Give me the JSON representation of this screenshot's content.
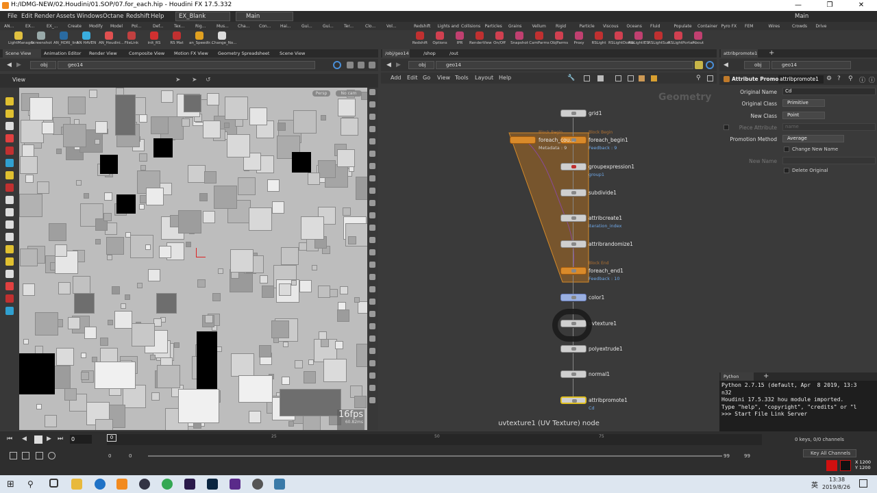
{
  "window": {
    "title": "H:/IDMG-NEW/02.Houdini/01.SOP/07.for_each.hip - Houdini FX 17.5.332"
  },
  "menu": [
    "File",
    "Edit",
    "Render",
    "Assets",
    "Windows",
    "Octane",
    "Redshift",
    "Help"
  ],
  "desktop": "EX_Blank",
  "main_label": "Main",
  "main_label_right": "Main",
  "shelf_tabs_left": [
    "AN...",
    "EX...",
    "EX_...",
    "Create",
    "Modify",
    "Model",
    "Pol...",
    "Def...",
    "Tex...",
    "Rig...",
    "Mus...",
    "Cha...",
    "Con...",
    "Hai...",
    "Gui...",
    "Gui...",
    "Ter...",
    "Clo...",
    "Vol..."
  ],
  "shelf_tabs_right": [
    "Redshift",
    "Lights and ...",
    "Collisions",
    "Particles",
    "Grains",
    "Vellum",
    "Rigid Bodies",
    "Particle Fl...",
    "Viscous Fl...",
    "Oceans",
    "Fluid Cont...",
    "Populate C...",
    "Container ...",
    "Pyro FX",
    "FEM",
    "Wires",
    "Crowds",
    "Drive Sim..."
  ],
  "tools_left": [
    "LightManager",
    "Screenshot",
    "AN_HDRI_link",
    "AN HAVEN",
    "AN_Houdini...",
    "FileLink",
    "init_RS",
    "RS Mat",
    "an_Speedtr...",
    "Change_No..."
  ],
  "tools_right": [
    "Redshift",
    "Options",
    "IPR",
    "RenderView",
    "On/Off",
    "Snapshot",
    "CamParms",
    "ObjParms",
    "Proxy",
    "RSLight",
    "RSLightDome",
    "RSLightIES",
    "RSLightSun",
    "RSLightPortal",
    "About"
  ],
  "left_tabs": [
    "Scene View",
    "Animation Editor",
    "Render View",
    "Composite View",
    "Motion FX View",
    "Geometry Spreadsheet",
    "Scene View"
  ],
  "left_path": [
    "obj",
    "geo14"
  ],
  "viewport": {
    "label": "View",
    "persp": "Persp",
    "nocam": "No cam",
    "fps": "16fps",
    "ms": "60.82ms"
  },
  "net_tabs": [
    "/obj/geo14",
    "/shop",
    "/out"
  ],
  "net_path": [
    "obj",
    "geo14"
  ],
  "net_menu": [
    "Add",
    "Edit",
    "Go",
    "View",
    "Tools",
    "Layout",
    "Help"
  ],
  "net_title": "Geometry",
  "nodes": [
    {
      "name": "grid1",
      "sub": ""
    },
    {
      "name": "foreach_begin1",
      "sub": "Feedback : 9",
      "tag": "Block Begin"
    },
    {
      "name": "groupexpression1",
      "sub": "group1"
    },
    {
      "name": "subdivide1",
      "sub": ""
    },
    {
      "name": "attribcreate1",
      "sub": "iteration_index"
    },
    {
      "name": "attribrandomize1",
      "sub": ""
    },
    {
      "name": "foreach_end1",
      "sub": "Feedback : 10",
      "tag": "Block End"
    },
    {
      "name": "color1",
      "sub": ""
    },
    {
      "name": "uvtexture1",
      "sub": ""
    },
    {
      "name": "polyextrude1",
      "sub": ""
    },
    {
      "name": "normal1",
      "sub": ""
    },
    {
      "name": "attribpromote1",
      "sub": "Cd"
    }
  ],
  "count_node": {
    "name": "foreach_cou...",
    "sub": "Metadata : 9",
    "tag": "Block Begin"
  },
  "net_status": "uvtexture1 (UV Texture) node",
  "parm_tab": "attribpromote1",
  "parm_path": [
    "obj",
    "geo14"
  ],
  "parm_header": {
    "type": "Attribute Promote",
    "name": "attribpromote1"
  },
  "parms": {
    "original_name_label": "Original Name",
    "original_name": "Cd",
    "original_class_label": "Original Class",
    "original_class": "Primitive",
    "new_class_label": "New Class",
    "new_class": "Point",
    "piece_attr_label": "Piece Attribute",
    "piece_attr": "name",
    "promo_label": "Promotion Method",
    "promo": "Average",
    "change_new_name": "Change New Name",
    "new_name_label": "New Name",
    "delete_original": "Delete Original"
  },
  "shell_tab": "Python Shell",
  "shell_lines": [
    "Python 2.7.15 (default, Apr  8 2019, 13:3",
    "n32",
    "Houdini 17.5.332 hou module imported.",
    "Type \"help\", \"copyright\", \"credits\" or \"l",
    ">>> Start File Link Server"
  ],
  "timeline": {
    "frame": "0",
    "frame_field": "0",
    "ticks": [
      "0",
      "25",
      "50",
      "75"
    ],
    "start": "0",
    "start2": "0",
    "end": "99",
    "end2": "99",
    "keys": "0 keys, 0/0 channels",
    "key_all": "Key All Channels",
    "x": "X 1200",
    "y": "Y 1200"
  },
  "clock": {
    "time": "13:38",
    "date": "2019/8/26"
  },
  "tray_lang": "英"
}
